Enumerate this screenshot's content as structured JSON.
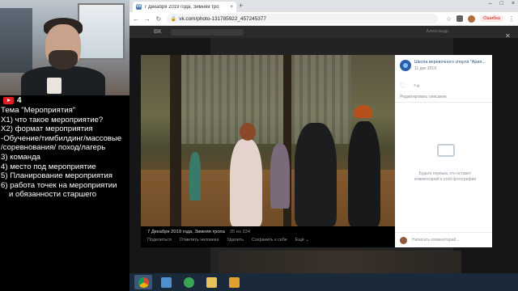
{
  "overlay": {
    "youtube_count": "4",
    "notes": [
      "Тема \"Мероприятия\"",
      "X1) что такое мероприятие?",
      "X2) формат мероприятия",
      "-Обучение/тимбилдинг/массовые",
      "/соревнования/ поход/лагерь",
      "3) команда",
      "4) место под мероприятие",
      "5) Планирование мероприятия",
      "6) работа точек на мероприятии",
      "и обязанности старшего"
    ]
  },
  "browser": {
    "tab_title": "7 Декабря 2019 года, Зимняя тро",
    "tab_close": "×",
    "new_tab": "+",
    "url": "vk.com/photo-131785922_457245377",
    "error_label": "Ошибка",
    "win_controls": [
      "–",
      "□",
      "×"
    ]
  },
  "vk": {
    "logo": "ВК",
    "user": "Александр",
    "close": "✕",
    "photo_caption": "7 Декабря 2019 года, Зимняя тропа",
    "photo_counter": "35 из 334",
    "photo_actions": [
      "Поделиться",
      "Отметить человека",
      "Удалить",
      "Сохранить к себе",
      "Ещё ⌄"
    ],
    "group_name": "Школа веревочного спорта \"Ария...",
    "post_date": "11 дек 2019",
    "edit_description": "Редактировать описание",
    "empty_comments": "Будьте первым, кто оставит комментарий к этой фотографии",
    "comment_placeholder": "Написать комментарий..."
  },
  "colors": {
    "vk_blue": "#4a76a8",
    "taskbar": "#1b2a3a",
    "error_red": "#c5221f"
  },
  "taskbar_icons": [
    "chrome-icon",
    "media-icon",
    "game-icon",
    "folder-icon",
    "player-icon"
  ]
}
